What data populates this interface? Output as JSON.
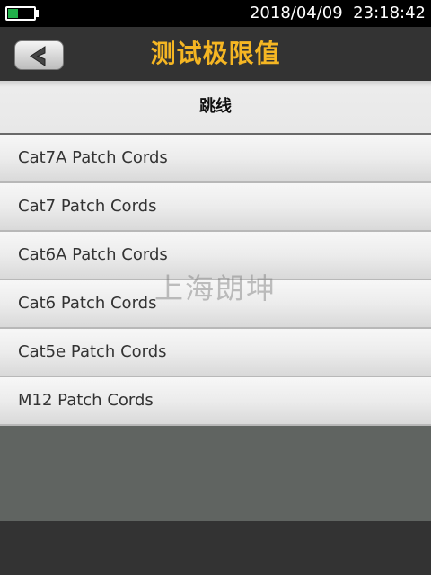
{
  "status_bar": {
    "datetime": "2018/04/09  23:18:42",
    "battery_level": 0.4,
    "battery_color": "#22b04a"
  },
  "header": {
    "title": "测试极限值",
    "title_color": "#f5b623",
    "back_icon": "chevron-left-icon"
  },
  "section": {
    "title": "跳线"
  },
  "items": [
    {
      "label": "Cat7A Patch Cords"
    },
    {
      "label": "Cat7 Patch Cords"
    },
    {
      "label": "Cat6A Patch Cords"
    },
    {
      "label": "Cat6 Patch Cords"
    },
    {
      "label": "Cat5e Patch Cords"
    },
    {
      "label": "M12 Patch Cords"
    }
  ],
  "watermark": "上海朗坤"
}
